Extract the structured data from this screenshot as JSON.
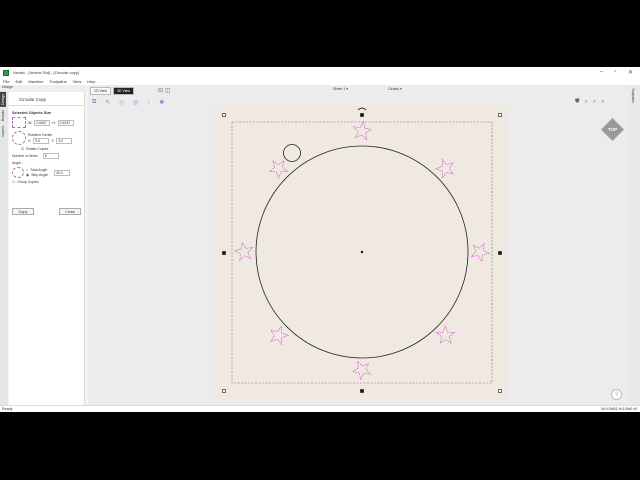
{
  "window": {
    "title": "Vectric - [Vectric Std] - [Circular copy]",
    "minimize": "–",
    "maximize": "▫",
    "close": "✕"
  },
  "menu": [
    "File",
    "Edit",
    "Machine",
    "Toolpaths",
    "View",
    "Help"
  ],
  "design_header": "Design",
  "left_tabs": [
    "Design",
    "Boards",
    "Layers"
  ],
  "panel": {
    "title": "Circular Copy",
    "selected_size_label": "Selected Objects Size",
    "w_label": "W:",
    "w_value": "0.6657",
    "h_label": "H:",
    "h_value": "0.6332",
    "rotation_center_label": "Rotation Center",
    "x_label": "X:",
    "x_value": "5.0",
    "y_label": "Y:",
    "y_value": "5.0",
    "rotate_copies_label": "Rotate Copies",
    "rotate_copies_checked": true,
    "num_items_label": "Number of items",
    "num_items_value": "8",
    "angle_label": "Angle ...",
    "total_angle_label": "Total Angle",
    "step_angle_label": "Step Angle",
    "angle_mode": "step",
    "angle_value": "45.0",
    "group_copies_label": "Group Copies",
    "group_copies_checked": false,
    "copy_button": "Copy",
    "close_button": "Close"
  },
  "view_tabs": [
    "2D View",
    "3D View"
  ],
  "active_view": "3D View",
  "sheet_selector": "Sheet 1 ▾",
  "layer_selector": "Circles ▾",
  "right_tab": "Toolpaths",
  "view_cube_label": "TOP",
  "help_icon": "?",
  "status": {
    "left": "Ready",
    "right": "W:0.0M01 H:0.0M0 x0"
  },
  "colors": {
    "star": "#d040d0",
    "wood": "#efe9e2",
    "accent": "#2e9e44"
  }
}
